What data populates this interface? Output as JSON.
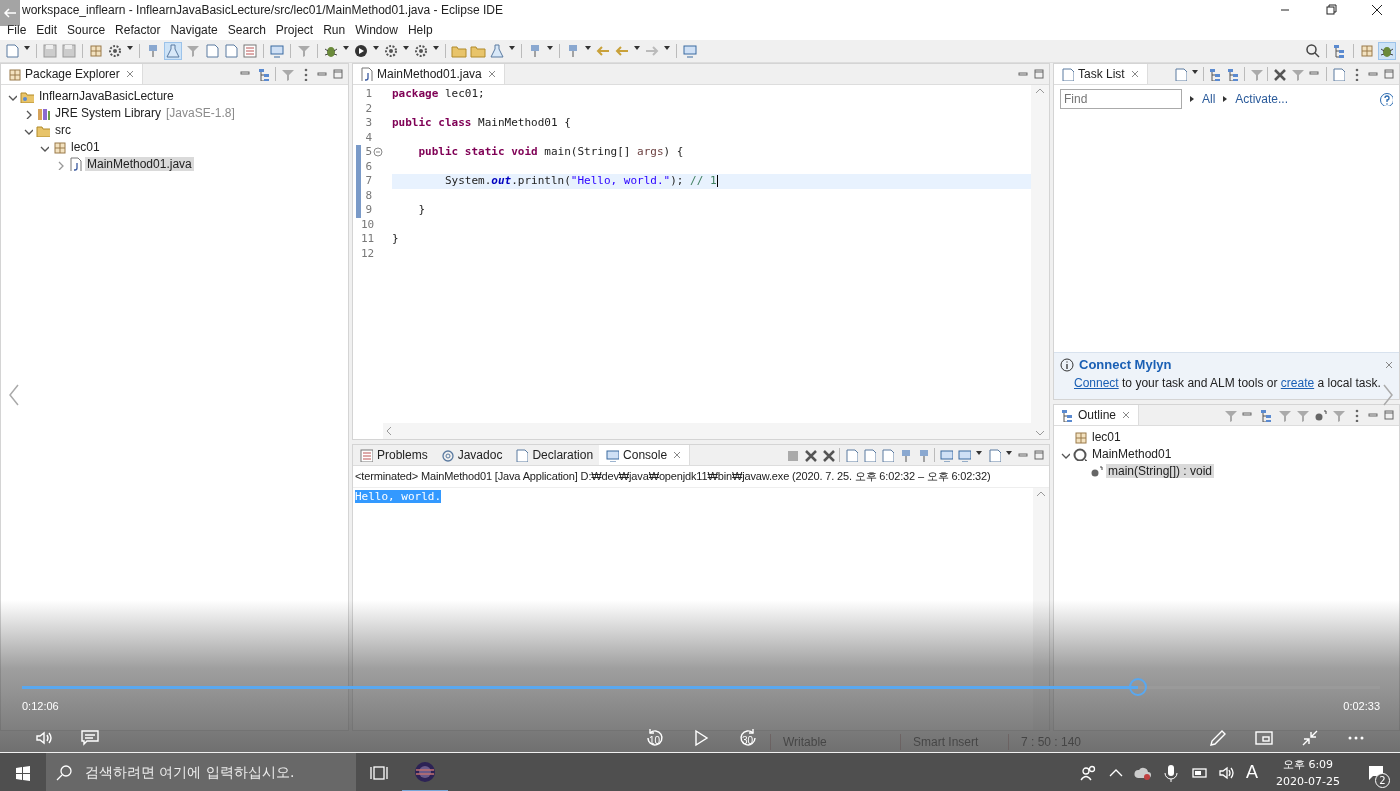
{
  "window": {
    "title": "workspace_inflearn - InflearnJavaBasicLecture/src/lec01/MainMethod01.java - Eclipse IDE"
  },
  "menu": [
    "File",
    "Edit",
    "Source",
    "Refactor",
    "Navigate",
    "Search",
    "Project",
    "Run",
    "Window",
    "Help"
  ],
  "package_explorer": {
    "tab": "Package Explorer",
    "tree": [
      {
        "label": "InflearnJavaBasicLecture",
        "kind": "project",
        "expanded": true,
        "selected": false,
        "children": [
          {
            "label": "JRE System Library",
            "note": "[JavaSE-1.8]",
            "kind": "library",
            "expanded": false,
            "selected": false
          },
          {
            "label": "src",
            "kind": "folder",
            "expanded": true,
            "selected": false,
            "children": [
              {
                "label": "lec01",
                "kind": "package",
                "expanded": true,
                "selected": false,
                "children": [
                  {
                    "label": "MainMethod01.java",
                    "kind": "file",
                    "expanded": false,
                    "selected": true
                  }
                ]
              }
            ]
          }
        ]
      }
    ]
  },
  "editor": {
    "tab": "MainMethod01.java",
    "lines": [
      {
        "number": "1",
        "current": false,
        "fold": false,
        "segments": [
          {
            "text": "package",
            "kind": "keyword"
          },
          {
            "text": " lec01;",
            "kind": "plain"
          }
        ]
      },
      {
        "number": "2",
        "current": false,
        "fold": false
      },
      {
        "number": "3",
        "current": false,
        "fold": false,
        "segments": [
          {
            "text": "public class",
            "kind": "keyword"
          },
          {
            "text": " MainMethod01 {",
            "kind": "plain"
          }
        ]
      },
      {
        "number": "4",
        "current": false,
        "fold": false
      },
      {
        "number": "5",
        "current": false,
        "fold": true,
        "segments": [
          {
            "text": "    public static void",
            "kind": "keyword"
          },
          {
            "text": " main(String[] ",
            "kind": "plain"
          },
          {
            "text": "args",
            "kind": "param"
          },
          {
            "text": ") {",
            "kind": "plain"
          }
        ]
      },
      {
        "number": "6",
        "current": false,
        "fold": false
      },
      {
        "number": "7",
        "current": true,
        "fold": false,
        "segments": [
          {
            "text": "        System.",
            "kind": "plain"
          },
          {
            "text": "out",
            "kind": "field"
          },
          {
            "text": ".println(",
            "kind": "plain"
          },
          {
            "text": "\"Hello, world.\"",
            "kind": "string"
          },
          {
            "text": "); ",
            "kind": "plain"
          },
          {
            "text": "// 1",
            "kind": "comment"
          }
        ]
      },
      {
        "number": "8",
        "current": false,
        "fold": false
      },
      {
        "number": "9",
        "current": false,
        "fold": false,
        "segments": [
          {
            "text": "    }",
            "kind": "plain"
          }
        ]
      },
      {
        "number": "10",
        "current": false,
        "fold": false
      },
      {
        "number": "11",
        "current": false,
        "fold": false,
        "segments": [
          {
            "text": "}",
            "kind": "plain"
          }
        ]
      },
      {
        "number": "12",
        "current": false,
        "fold": false
      }
    ]
  },
  "bottom_panel": {
    "tabs": [
      {
        "label": "Problems",
        "selected": false
      },
      {
        "label": "Javadoc",
        "selected": false
      },
      {
        "label": "Declaration",
        "selected": false
      },
      {
        "label": "Console",
        "selected": true
      }
    ],
    "console_header": "<terminated> MainMethod01 [Java Application] D:₩dev₩java₩openjdk11₩bin₩javaw.exe  (2020. 7. 25. 오후 6:02:32 – 오후 6:02:32)",
    "output": "Hello, world."
  },
  "task_list": {
    "tab": "Task List",
    "find_placeholder": "Find",
    "filters": [
      "All",
      "Activate..."
    ]
  },
  "mylyn": {
    "title": "Connect Mylyn",
    "message": [
      {
        "text": "Connect",
        "link": true
      },
      {
        "text": " to your task and ALM tools or ",
        "link": false
      },
      {
        "text": "create",
        "link": true
      },
      {
        "text": " a local task.",
        "link": false
      }
    ]
  },
  "outline": {
    "tab": "Outline",
    "tree": [
      {
        "label": "lec01",
        "kind": "package",
        "selected": false
      },
      {
        "label": "MainMethod01",
        "kind": "class",
        "expanded": true,
        "selected": false,
        "children": [
          {
            "label": "main(String[]) : void",
            "kind": "method",
            "selected": true
          }
        ]
      }
    ]
  },
  "status_bar": [
    "Writable",
    "Smart Insert",
    "7 : 50 : 140"
  ],
  "player": {
    "elapsed": "0:12:06",
    "remaining": "0:02:33",
    "level": 0.822,
    "rewind": "10",
    "forward": "30"
  },
  "taskbar": {
    "search_placeholder": "검색하려면 여기에 입력하십시오.",
    "time": "오후 6:09",
    "date": "2020-07-25",
    "ime": "A",
    "notifications": "2"
  }
}
